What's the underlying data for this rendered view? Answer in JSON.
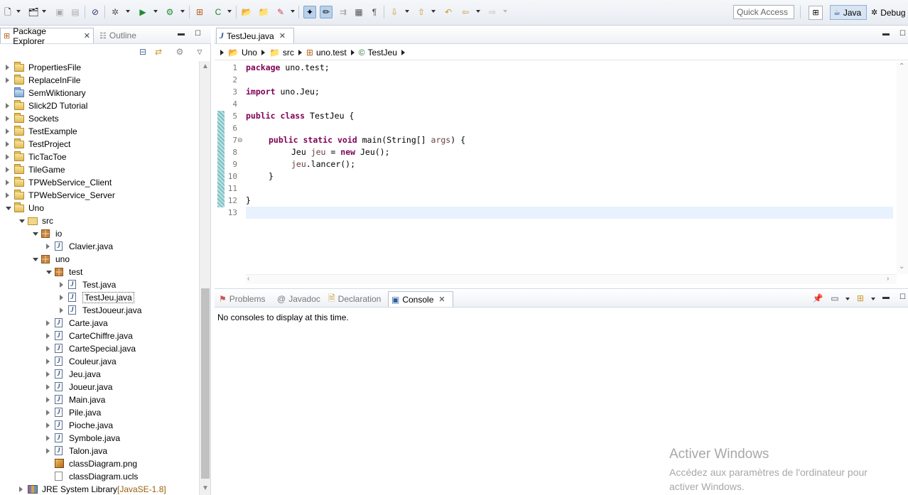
{
  "toolbar": {
    "quick_access": "Quick Access",
    "perspectives": [
      {
        "label": "Java",
        "active": true
      },
      {
        "label": "Debug",
        "active": false
      }
    ]
  },
  "package_explorer": {
    "tabs": [
      {
        "label": "Package Explorer",
        "selected": true
      },
      {
        "label": "Outline",
        "selected": false
      }
    ],
    "tree": [
      {
        "label": "PropertiesFile",
        "depth": 0,
        "kind": "project",
        "expanded": false
      },
      {
        "label": "ReplaceInFile",
        "depth": 0,
        "kind": "project",
        "expanded": false
      },
      {
        "label": "SemWiktionary",
        "depth": 0,
        "kind": "project-blue",
        "expanded": null
      },
      {
        "label": "Slick2D Tutorial",
        "depth": 0,
        "kind": "project",
        "expanded": false
      },
      {
        "label": "Sockets",
        "depth": 0,
        "kind": "project",
        "expanded": false
      },
      {
        "label": "TestExample",
        "depth": 0,
        "kind": "project",
        "expanded": false
      },
      {
        "label": "TestProject",
        "depth": 0,
        "kind": "project",
        "expanded": false
      },
      {
        "label": "TicTacToe",
        "depth": 0,
        "kind": "project",
        "expanded": false
      },
      {
        "label": "TileGame",
        "depth": 0,
        "kind": "project",
        "expanded": false
      },
      {
        "label": "TPWebService_Client",
        "depth": 0,
        "kind": "project",
        "expanded": false
      },
      {
        "label": "TPWebService_Server",
        "depth": 0,
        "kind": "project",
        "expanded": false
      },
      {
        "label": "Uno",
        "depth": 0,
        "kind": "project",
        "expanded": true
      },
      {
        "label": "src",
        "depth": 1,
        "kind": "src",
        "expanded": true
      },
      {
        "label": "io",
        "depth": 2,
        "kind": "package",
        "expanded": true
      },
      {
        "label": "Clavier.java",
        "depth": 3,
        "kind": "java",
        "expanded": false
      },
      {
        "label": "uno",
        "depth": 2,
        "kind": "package",
        "expanded": true
      },
      {
        "label": "test",
        "depth": 3,
        "kind": "package",
        "expanded": true
      },
      {
        "label": "Test.java",
        "depth": 4,
        "kind": "java",
        "expanded": false
      },
      {
        "label": "TestJeu.java",
        "depth": 4,
        "kind": "java",
        "expanded": false,
        "selected": true
      },
      {
        "label": "TestJoueur.java",
        "depth": 4,
        "kind": "java",
        "expanded": false
      },
      {
        "label": "Carte.java",
        "depth": 3,
        "kind": "java",
        "expanded": false
      },
      {
        "label": "CarteChiffre.java",
        "depth": 3,
        "kind": "java",
        "expanded": false
      },
      {
        "label": "CarteSpecial.java",
        "depth": 3,
        "kind": "java",
        "expanded": false
      },
      {
        "label": "Couleur.java",
        "depth": 3,
        "kind": "java",
        "expanded": false
      },
      {
        "label": "Jeu.java",
        "depth": 3,
        "kind": "java",
        "expanded": false
      },
      {
        "label": "Joueur.java",
        "depth": 3,
        "kind": "java",
        "expanded": false
      },
      {
        "label": "Main.java",
        "depth": 3,
        "kind": "java",
        "expanded": false
      },
      {
        "label": "Pile.java",
        "depth": 3,
        "kind": "java",
        "expanded": false
      },
      {
        "label": "Pioche.java",
        "depth": 3,
        "kind": "java",
        "expanded": false
      },
      {
        "label": "Symbole.java",
        "depth": 3,
        "kind": "java",
        "expanded": false
      },
      {
        "label": "Talon.java",
        "depth": 3,
        "kind": "java",
        "expanded": false
      },
      {
        "label": "classDiagram.png",
        "depth": 3,
        "kind": "image",
        "expanded": null
      },
      {
        "label": "classDiagram.ucls",
        "depth": 3,
        "kind": "file",
        "expanded": null
      },
      {
        "label": "JRE System Library",
        "depth": 1,
        "kind": "library",
        "expanded": false,
        "decoration": "[JavaSE-1.8]"
      }
    ]
  },
  "editor": {
    "tab": {
      "label": "TestJeu.java"
    },
    "breadcrumb": [
      "Uno",
      "src",
      "uno.test",
      "TestJeu"
    ],
    "lines": [
      {
        "n": "1",
        "changed": false,
        "fold": ""
      },
      {
        "n": "2",
        "changed": false,
        "fold": ""
      },
      {
        "n": "3",
        "changed": false,
        "fold": ""
      },
      {
        "n": "4",
        "changed": false,
        "fold": ""
      },
      {
        "n": "5",
        "changed": true,
        "fold": ""
      },
      {
        "n": "6",
        "changed": true,
        "fold": ""
      },
      {
        "n": "7",
        "changed": true,
        "fold": "⊖"
      },
      {
        "n": "8",
        "changed": true,
        "fold": ""
      },
      {
        "n": "9",
        "changed": true,
        "fold": ""
      },
      {
        "n": "10",
        "changed": true,
        "fold": ""
      },
      {
        "n": "11",
        "changed": true,
        "fold": ""
      },
      {
        "n": "12",
        "changed": true,
        "fold": ""
      },
      {
        "n": "13",
        "changed": false,
        "fold": ""
      }
    ],
    "code": {
      "l1_kw": "package",
      "l1_rest": " uno.test;",
      "l3_kw": "import",
      "l3_rest": " uno.Jeu;",
      "l5_kw1": "public",
      "l5_kw2": "class",
      "l5_rest": " TestJeu {",
      "l7_kw1": "public",
      "l7_kw2": "static",
      "l7_kw3": "void",
      "l7_rest": " main(String[] ",
      "l7_var": "args",
      "l7_end": ") {",
      "l8_a": "Jeu ",
      "l8_var": "jeu",
      "l8_b": " = ",
      "l8_kw": "new",
      "l8_c": " Jeu();",
      "l9_var": "jeu",
      "l9_rest": ".lancer();",
      "l10": "}",
      "l12": "}"
    }
  },
  "console": {
    "tabs": [
      {
        "label": "Problems",
        "selected": false
      },
      {
        "label": "Javadoc",
        "selected": false
      },
      {
        "label": "Declaration",
        "selected": false
      },
      {
        "label": "Console",
        "selected": true
      }
    ],
    "message": "No consoles to display at this time."
  },
  "watermark": {
    "title": "Activer Windows",
    "subtitle": "Accédez aux paramètres de l'ordinateur pour activer Windows."
  }
}
